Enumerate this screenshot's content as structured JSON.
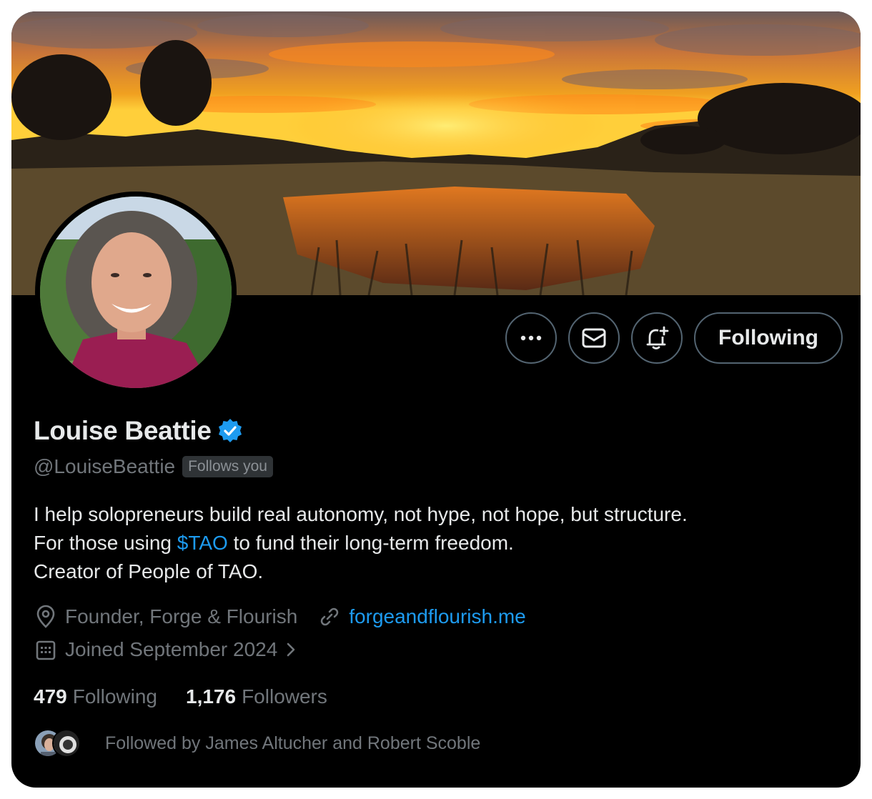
{
  "profile": {
    "name": "Louise Beattie",
    "handle": "@LouiseBeattie",
    "follows_you_badge": "Follows you",
    "verified_icon": "verified-badge-icon",
    "bio_line1": "I help solopreneurs build real autonomy, not hype, not hope, but structure.",
    "bio_line2_before": "For those using ",
    "bio_cashtag": "$TAO",
    "bio_line2_after": " to fund their long-term freedom.",
    "bio_line3": "Creator of People of TAO.",
    "location": "Founder, Forge & Flourish",
    "website": "forgeandflourish.me",
    "joined": "Joined September 2024",
    "following_count": "479",
    "following_label": "Following",
    "followers_count": "1,176",
    "followers_label": "Followers",
    "followed_by": "Followed by James Altucher and Robert Scoble"
  },
  "actions": {
    "more_icon": "more-dots-icon",
    "message_icon": "mail-icon",
    "notify_icon": "bell-plus-icon",
    "follow_label": "Following"
  },
  "colors": {
    "background": "#000000",
    "text_primary": "#e7e9ea",
    "text_secondary": "#71767b",
    "link": "#1d9bf0",
    "border": "#536471"
  }
}
